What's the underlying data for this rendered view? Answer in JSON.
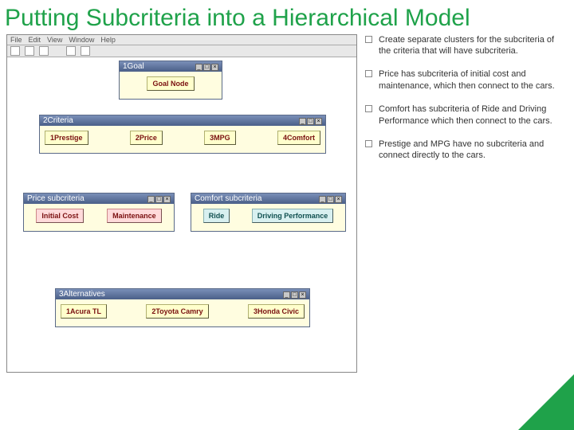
{
  "title": "Putting Subcriteria into a Hierarchical Model",
  "bullets": [
    "Create separate clusters for the subcriteria of the criteria that will have subcriteria.",
    " Price has subcriteria of initial cost and maintenance, which then connect to the cars.",
    "Comfort has subcriteria of Ride and Driving Performance which then connect to the cars.",
    "Prestige and MPG have no subcriteria and connect directly to the cars."
  ],
  "app": {
    "menu": [
      "File",
      "Edit",
      "View",
      "Window",
      "Help"
    ],
    "panes": {
      "goal": {
        "title": "1Goal",
        "nodes": [
          "Goal Node"
        ]
      },
      "criteria": {
        "title": "2Criteria",
        "nodes": [
          "1Prestige",
          "2Price",
          "3MPG",
          "4Comfort"
        ]
      },
      "price": {
        "title": "Price subcriteria",
        "nodes": [
          "Initial Cost",
          "Maintenance"
        ]
      },
      "comfort": {
        "title": "Comfort subcriteria",
        "nodes": [
          "Ride",
          "Driving Performance"
        ]
      },
      "alt": {
        "title": "3Alternatives",
        "nodes": [
          "1Acura TL",
          "2Toyota Camry",
          "3Honda Civic"
        ]
      }
    }
  }
}
